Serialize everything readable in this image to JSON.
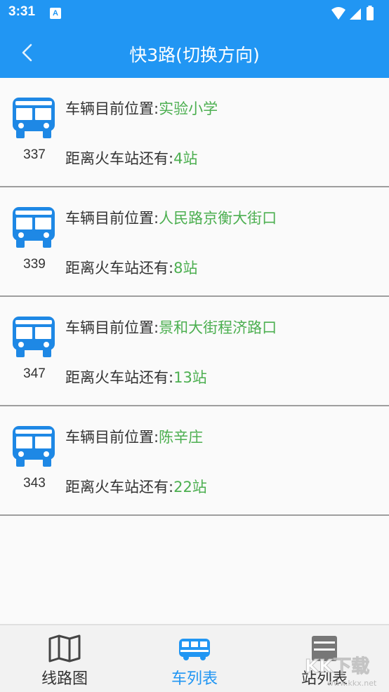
{
  "status_bar": {
    "time": "3:31",
    "notif_icon": "A"
  },
  "app_bar": {
    "title": "快3路(切换方向)"
  },
  "colors": {
    "primary": "#2196f3",
    "value_green": "#4caf50"
  },
  "buses": [
    {
      "number": "337",
      "position_label": "车辆目前位置:",
      "position_value": "实验小学",
      "distance_label": "距离火车站还有:",
      "distance_value": "4站"
    },
    {
      "number": "339",
      "position_label": "车辆目前位置:",
      "position_value": "人民路京衡大街口",
      "distance_label": "距离火车站还有:",
      "distance_value": "8站"
    },
    {
      "number": "347",
      "position_label": "车辆目前位置:",
      "position_value": "景和大街程济路口",
      "distance_label": "距离火车站还有:",
      "distance_value": "13站"
    },
    {
      "number": "343",
      "position_label": "车辆目前位置:",
      "position_value": "陈辛庄",
      "distance_label": "距离火车站还有:",
      "distance_value": "22站"
    }
  ],
  "bottom_nav": {
    "tabs": [
      {
        "label": "线路图",
        "icon": "map-icon"
      },
      {
        "label": "车列表",
        "icon": "bus-icon"
      },
      {
        "label": "站列表",
        "icon": "stop-list-icon"
      }
    ]
  },
  "watermark": {
    "text": "KK下载",
    "sub": "www.kkx.net"
  }
}
